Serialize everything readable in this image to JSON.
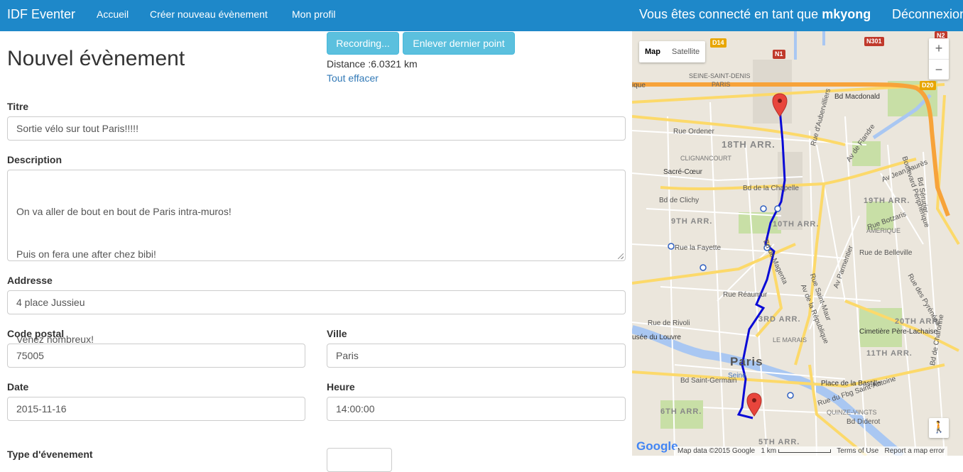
{
  "navbar": {
    "brand": "IDF Eventer",
    "links": [
      "Accueil",
      "Créer nouveau évènement",
      "Mon profil"
    ],
    "connected_prefix": "Vous êtes connecté en tant que ",
    "username": "mkyong",
    "logout": "Déconnexion"
  },
  "page_title": "Nouvel évènement",
  "route": {
    "recording_button": "Recording...",
    "remove_last_button": "Enlever dernier point",
    "distance": "Distance :6.0321 km",
    "clear_link": "Tout effacer"
  },
  "form": {
    "titre_label": "Titre",
    "titre_value": "Sortie vélo sur tout Paris!!!!!",
    "description_label": "Description",
    "description_lines": {
      "l1": "On va aller de bout en bout de Paris intra-muros!",
      "l2": "Puis on fera une after chez bibi!",
      "l3": "",
      "l4": "Venez nombreux!"
    },
    "addresse_label": "Addresse",
    "addresse_value": "4 place Jussieu",
    "code_postal_label": "Code postal",
    "code_postal_value": "75005",
    "ville_label": "Ville",
    "ville_value": "Paris",
    "date_label": "Date",
    "date_value": "2015-11-16",
    "heure_label": "Heure",
    "heure_value": "14:00:00",
    "type_label": "Type d'évenement"
  },
  "map": {
    "type_map": "Map",
    "type_satellite": "Satellite",
    "zoom_in": "+",
    "zoom_out": "−",
    "google": "Google",
    "footer": {
      "data": "Map data ©2015 Google",
      "scale": "1 km",
      "terms": "Terms of Use",
      "report": "Report a map error"
    },
    "labels": {
      "seine_st_denis": "SEINE-SAINT-DENIS",
      "paris_top": "PARIS",
      "bd_macdonald": "Bd Macdonald",
      "rue_ordener": "Rue Ordener",
      "arr18": "18TH ARR.",
      "clignancourt": "CLIGNANCOURT",
      "sacre_coeur": "Sacré-Cœur",
      "bd_chapelle": "Bd de la Chapelle",
      "bd_clichy": "Bd de Clichy",
      "arr19": "19TH ARR.",
      "arr9": "9TH ARR.",
      "arr10": "10TH ARR.",
      "rue_lafayette": "Rue la Fayette",
      "rue_belleville": "Rue de Belleville",
      "amerique": "AMÉRIQUE",
      "arr3": "3RD ARR.",
      "arr20": "20TH ARR.",
      "le_marais": "LE MARAIS",
      "pere_lachaise": "Cimetière Père-Lachaise",
      "musee_louvre": "usée du Louvre",
      "paris_center": "Paris",
      "arr11": "11TH ARR.",
      "place_bastille": "Place de la Bastille",
      "arr6": "6TH ARR.",
      "quinze_vingts": "QUINZE-VINGTS",
      "bd_diderot": "Bd Diderot",
      "arr5": "5TH ARR.",
      "st_germain": "Bd Saint-Germain",
      "bd_peripherique": "Boulevard Périphérique",
      "av_flandre": "Av de Flandre",
      "rue_magenta": "Bd de Magenta",
      "rue_reaumur": "Rue Réaumur",
      "rue_rivoli": "Rue de Rivoli",
      "av_republique": "Av de la République",
      "rue_st_maur": "Rue Saint-Maur",
      "av_parmentier": "Av Parmentier",
      "rue_aubervilliers": "Rue d'Aubervilliers",
      "av_jaures": "Av Jean Jaurès",
      "bd_serurier": "Bd Sérurier",
      "rue_botzaris": "Rue Botzaris",
      "rue_pyrenees": "Rue des Pyrénées",
      "bd_charonne": "Bd de Charonne",
      "seine": "Seine",
      "ique": "ique",
      "rue_faubourg": "Rue du Fbg Saint-Antoine"
    },
    "badges": {
      "d14": "D14",
      "n1": "N1",
      "n301": "N301",
      "d20": "D20",
      "n2": "N2"
    },
    "colors": {
      "route": "#0a0ad6",
      "highway": "#f7a33a",
      "major_road": "#fcd96a",
      "park": "#c8dfa6",
      "water": "#a9c7f2",
      "marker": "#e8453c"
    }
  }
}
